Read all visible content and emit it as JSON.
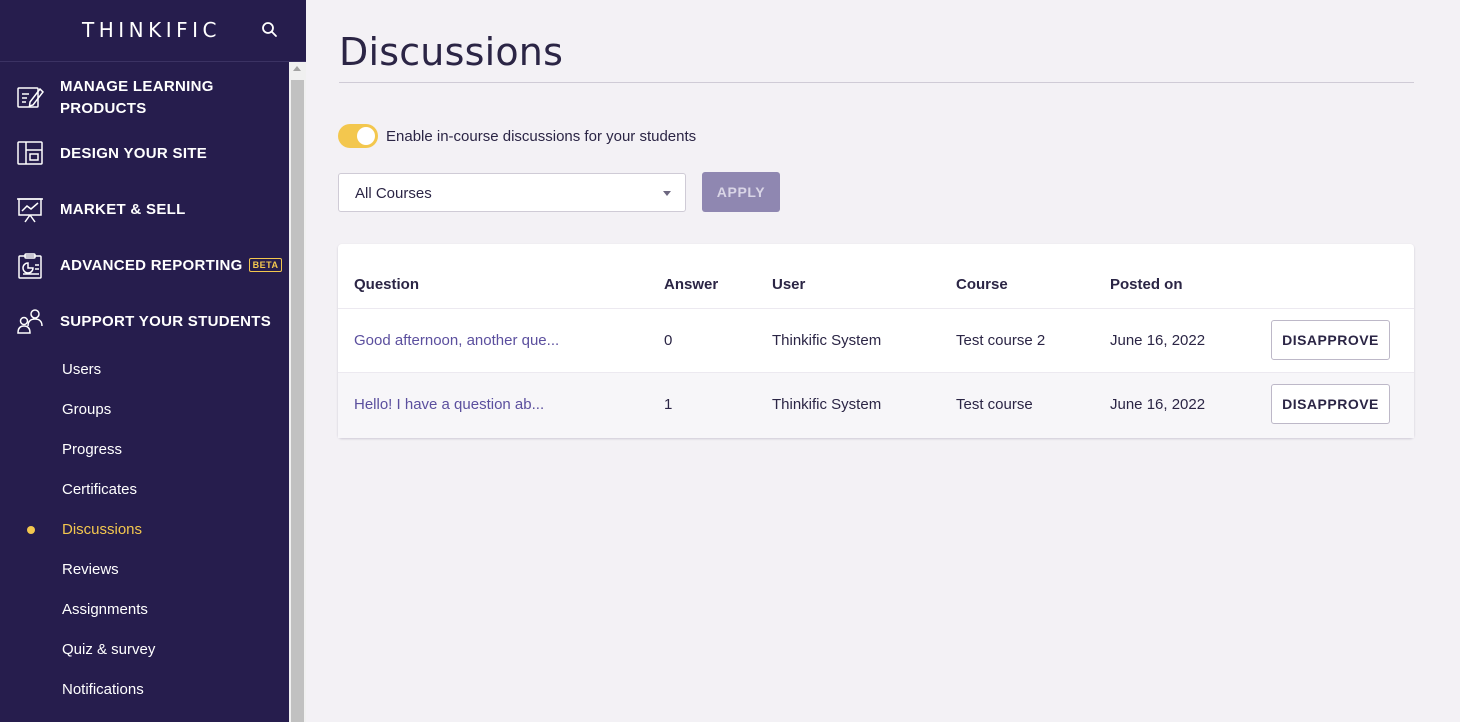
{
  "sidebar": {
    "brand": "THINKIFIC",
    "nav_items": [
      {
        "label": "MANAGE LEARNING PRODUCTS",
        "icon": "edit-document-icon"
      },
      {
        "label": "DESIGN YOUR SITE",
        "icon": "layout-icon"
      },
      {
        "label": "MARKET & SELL",
        "icon": "chart-presentation-icon"
      },
      {
        "label": "ADVANCED REPORTING",
        "icon": "report-clipboard-icon",
        "badge": "BETA"
      },
      {
        "label": "SUPPORT YOUR STUDENTS",
        "icon": "users-icon"
      }
    ],
    "sub_items": [
      "Users",
      "Groups",
      "Progress",
      "Certificates",
      "Discussions",
      "Reviews",
      "Assignments",
      "Quiz & survey",
      "Notifications"
    ],
    "active_sub_item": "Discussions"
  },
  "main": {
    "title": "Discussions",
    "toggle": {
      "label": "Enable in-course discussions for your students",
      "on": true
    },
    "filter": {
      "selected": "All Courses"
    },
    "apply_label": "APPLY",
    "table": {
      "headers": [
        "Question",
        "Answer",
        "User",
        "Course",
        "Posted on"
      ],
      "rows": [
        {
          "question": "Good afternoon, another que...",
          "answer": "0",
          "user": "Thinkific System",
          "course": "Test course 2",
          "posted": "June 16, 2022",
          "action": "DISAPPROVE"
        },
        {
          "question": "Hello! I have a question ab...",
          "answer": "1",
          "user": "Thinkific System",
          "course": "Test course",
          "posted": "June 16, 2022",
          "action": "DISAPPROVE"
        }
      ]
    }
  },
  "colors": {
    "sidebar_bg": "#261d4d",
    "accent": "#f3c74e",
    "link": "#5b4f9e",
    "apply_disabled": "#8f87b1"
  }
}
